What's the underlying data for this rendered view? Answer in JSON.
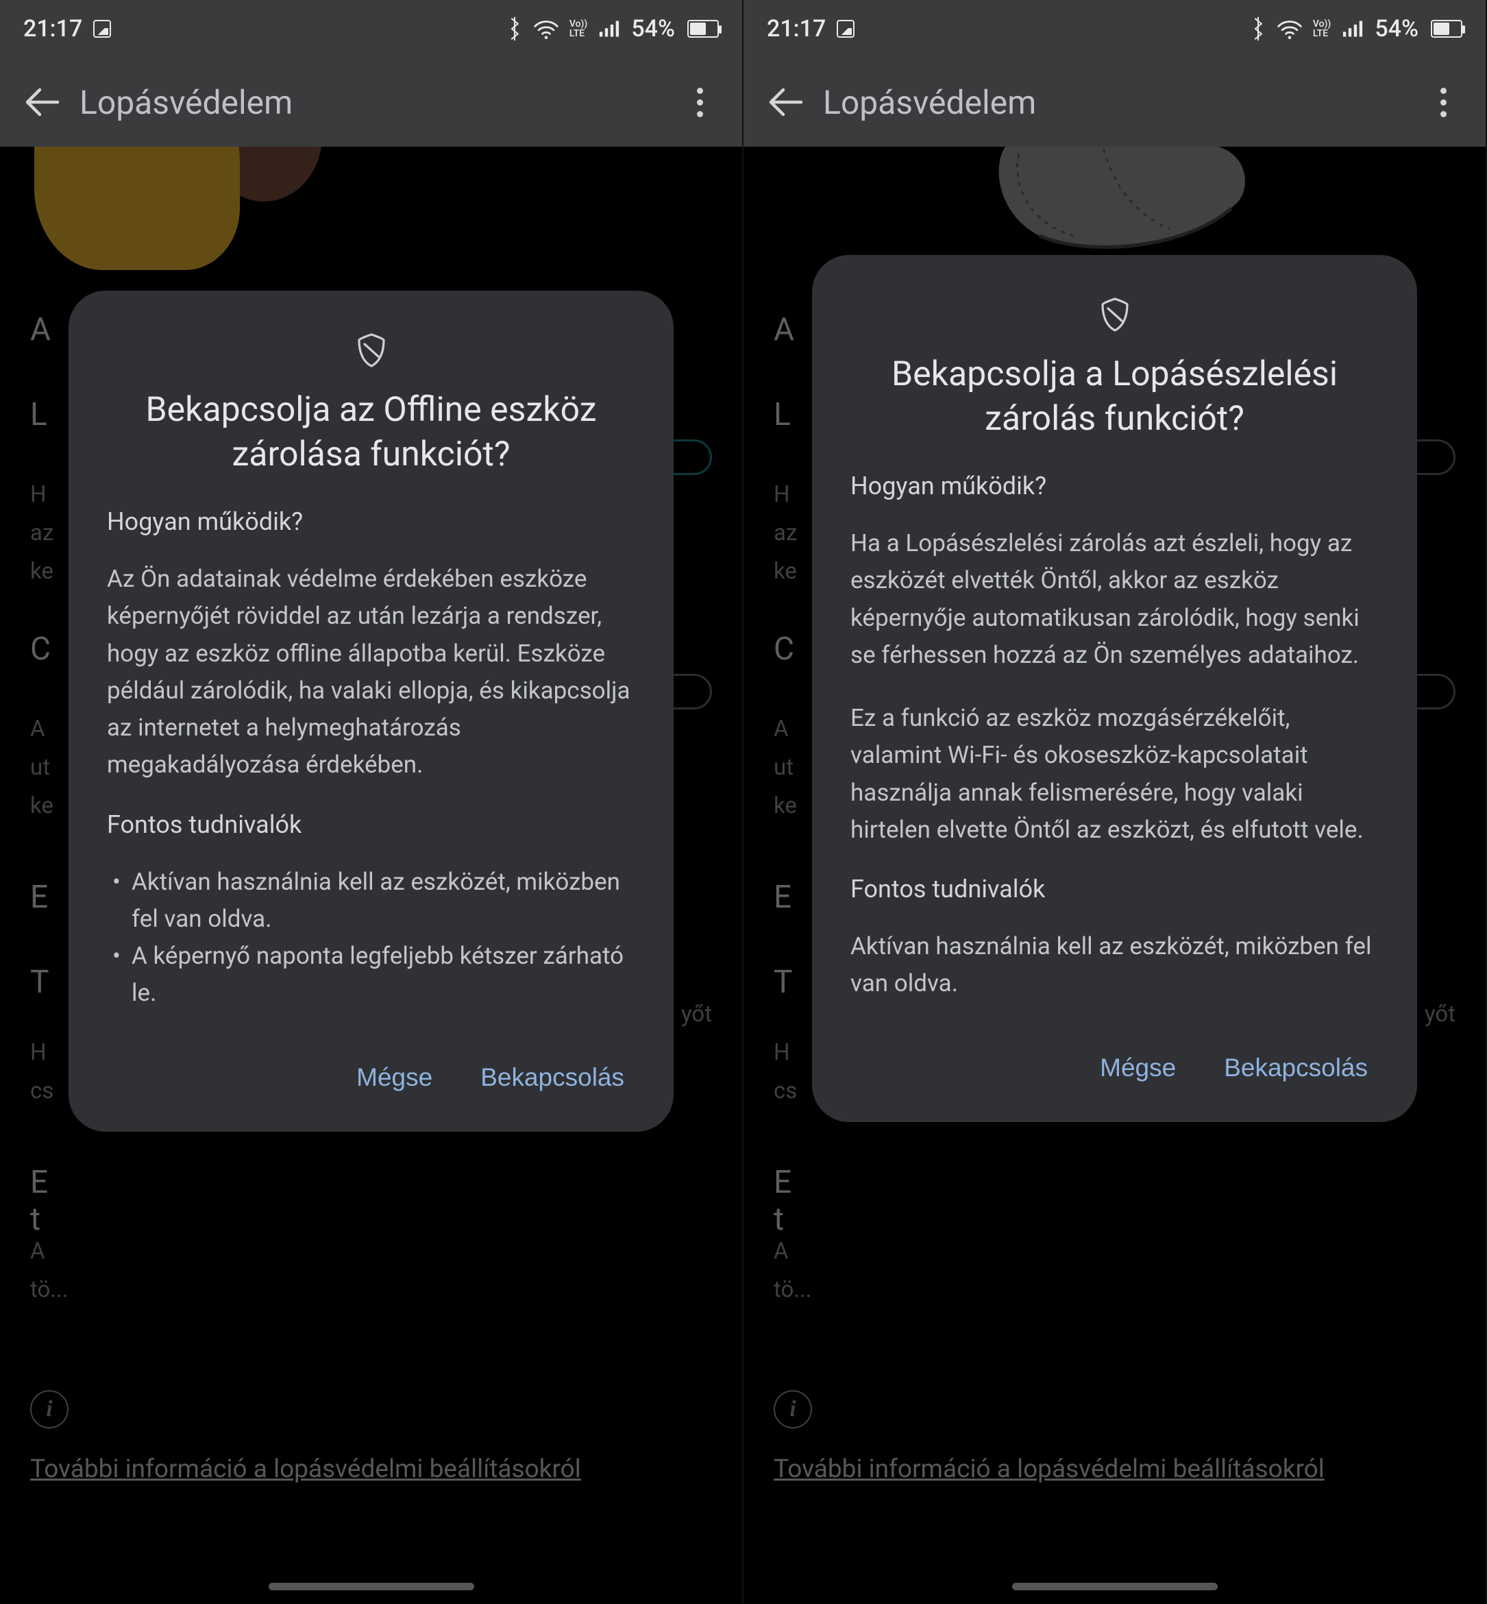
{
  "status": {
    "time": "21:17",
    "battery": "54%",
    "volte": "Vo))\nLTE"
  },
  "appbar": {
    "title": "Lopásvédelem"
  },
  "bg": {
    "letterA": "A",
    "letterL": "L",
    "letterC": "C",
    "letterE1": "E",
    "letterT": "T",
    "letterE2": "E",
    "letter_t2": "t",
    "line_h1": "H",
    "line_az": "az",
    "line_ke": "ke",
    "line_a2": "A",
    "line_ut": "ut",
    "line_ke2": "ke",
    "line_yot": "yőt",
    "line_cs": "cs",
    "line_a3": "A",
    "line_to": "tö...",
    "info_link": "További információ a lopásvédelmi beállításokról"
  },
  "dialog_left": {
    "title": "Bekapcsolja az Offline eszköz zárolása funkciót?",
    "how_title": "Hogyan működik?",
    "body1": "Az Ön adatainak védelme érdekében eszköze képernyőjét röviddel az után lezárja a rendszer, hogy az eszköz offline állapotba kerül. Eszköze például zárolódik, ha valaki ellopja, és kikapcsolja az internetet a helymeghatározás megakadályozása érdekében.",
    "important_title": "Fontos tudnivalók",
    "bullet1": "Aktívan használnia kell az eszközét, miközben fel van oldva.",
    "bullet2": "A képernyő naponta legfeljebb kétszer zárható le.",
    "cancel": "Mégse",
    "confirm": "Bekapcsolás"
  },
  "dialog_right": {
    "title": "Bekapcsolja a Lopásészlelési zárolás funkciót?",
    "how_title": "Hogyan működik?",
    "body1": "Ha a Lopásészlelési zárolás azt észleli, hogy az eszközét elvették Öntől, akkor az eszköz képernyője automatikusan zárolódik, hogy senki se férhessen hozzá az Ön személyes adataihoz.",
    "body2": "Ez a funkció az eszköz mozgásérzékelőit, valamint Wi-Fi- és okoseszköz-kapcsolatait használja annak felismerésére, hogy valaki hirtelen elvette Öntől az eszközt, és elfutott vele.",
    "important_title": "Fontos tudnivalók",
    "body3": "Aktívan használnia kell az eszközét, miközben fel van oldva.",
    "cancel": "Mégse",
    "confirm": "Bekapcsolás"
  }
}
